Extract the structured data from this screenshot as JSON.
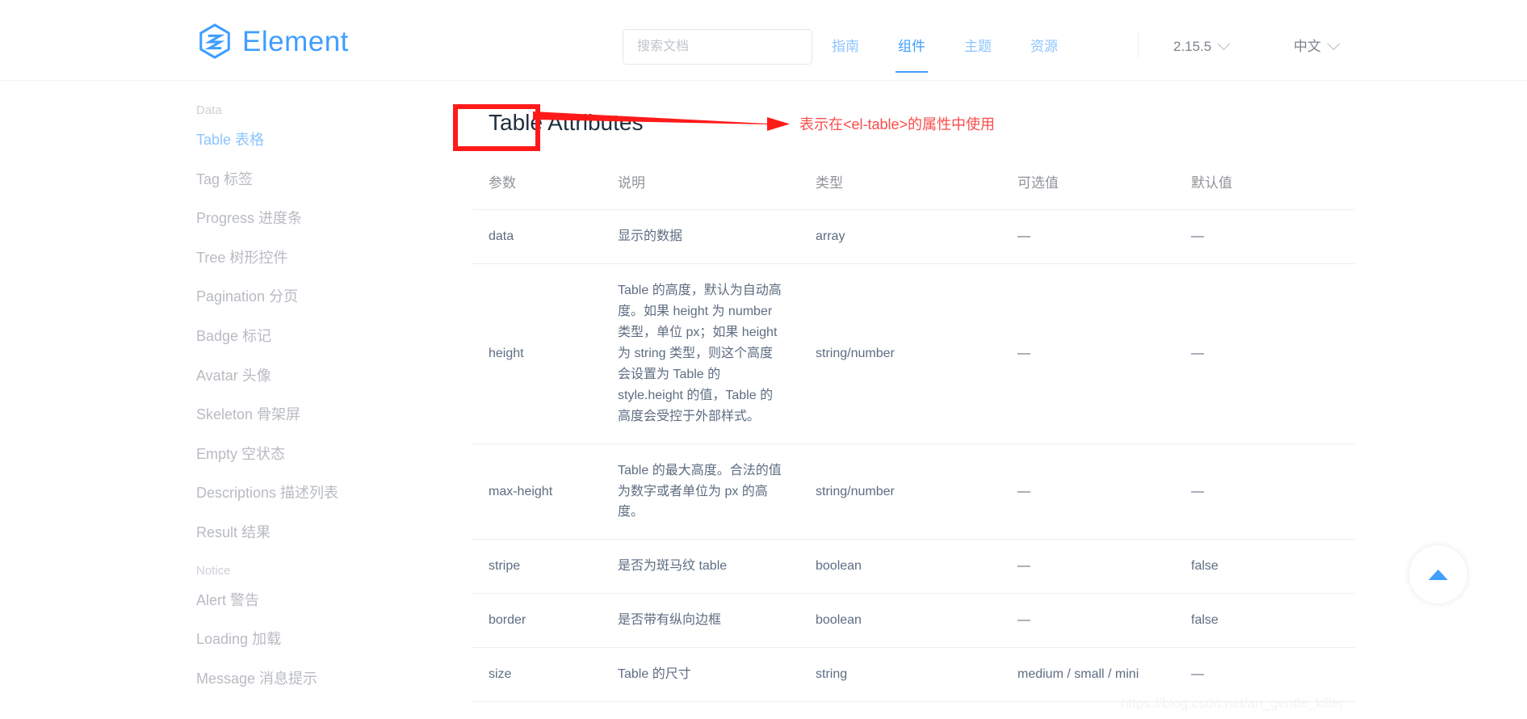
{
  "header": {
    "logo_text": "Element",
    "logo_icon": "element-hexagon-logo-icon",
    "search": {
      "placeholder": "搜索文档",
      "value": ""
    },
    "nav": [
      {
        "label": "指南",
        "active": false
      },
      {
        "label": "组件",
        "active": true
      },
      {
        "label": "主题",
        "active": false
      },
      {
        "label": "资源",
        "active": false
      }
    ],
    "version": "2.15.5",
    "language": "中文",
    "chevron_icon": "chevron-down-icon"
  },
  "sidebar": {
    "groups": [
      {
        "title": "Data",
        "items": [
          {
            "label": "Table 表格",
            "active": true
          },
          {
            "label": "Tag 标签",
            "active": false
          },
          {
            "label": "Progress 进度条",
            "active": false
          },
          {
            "label": "Tree 树形控件",
            "active": false
          },
          {
            "label": "Pagination 分页",
            "active": false
          },
          {
            "label": "Badge 标记",
            "active": false
          },
          {
            "label": "Avatar 头像",
            "active": false
          },
          {
            "label": "Skeleton 骨架屏",
            "active": false
          },
          {
            "label": "Empty 空状态",
            "active": false
          },
          {
            "label": "Descriptions 描述列表",
            "active": false
          },
          {
            "label": "Result 结果",
            "active": false
          }
        ]
      },
      {
        "title": "Notice",
        "items": [
          {
            "label": "Alert 警告",
            "active": false
          },
          {
            "label": "Loading 加载",
            "active": false
          },
          {
            "label": "Message 消息提示",
            "active": false
          }
        ]
      }
    ]
  },
  "main": {
    "title": "Table Attributes",
    "table": {
      "headers": [
        "参数",
        "说明",
        "类型",
        "可选值",
        "默认值"
      ],
      "rows": [
        {
          "param": "data",
          "desc": "显示的数据",
          "type": "array",
          "options": "—",
          "default": "—"
        },
        {
          "param": "height",
          "desc": "Table 的高度，默认为自动高度。如果 height 为 number 类型，单位 px；如果 height 为 string 类型，则这个高度会设置为 Table 的 style.height 的值，Table 的高度会受控于外部样式。",
          "type": "string/number",
          "options": "—",
          "default": "—"
        },
        {
          "param": "max-height",
          "desc": "Table 的最大高度。合法的值为数字或者单位为 px 的高度。",
          "type": "string/number",
          "options": "—",
          "default": "—"
        },
        {
          "param": "stripe",
          "desc": "是否为斑马纹 table",
          "type": "boolean",
          "options": "—",
          "default": "false"
        },
        {
          "param": "border",
          "desc": "是否带有纵向边框",
          "type": "boolean",
          "options": "—",
          "default": "false"
        },
        {
          "param": "size",
          "desc": "Table 的尺寸",
          "type": "string",
          "options": "medium / small / mini",
          "default": "—"
        }
      ]
    }
  },
  "annotation": {
    "text": "表示在<el-table>的属性中使用",
    "color": "#fc4b4b",
    "shapes": [
      "red-rectangle-highlight",
      "red-arrow-pointer"
    ]
  },
  "back_to_top": {
    "icon": "triangle-up-icon",
    "label": ""
  },
  "watermark": {
    "text": "https://blog.csdn.net/an_gentle_killer"
  },
  "colors": {
    "brand_blue": "#409eff",
    "nav_inactive": "#8cc5ff",
    "text_primary": "#1f2f3d",
    "text_body": "#5e6d82",
    "border": "#ebeef5",
    "annotation_red": "#ff1a1a"
  }
}
